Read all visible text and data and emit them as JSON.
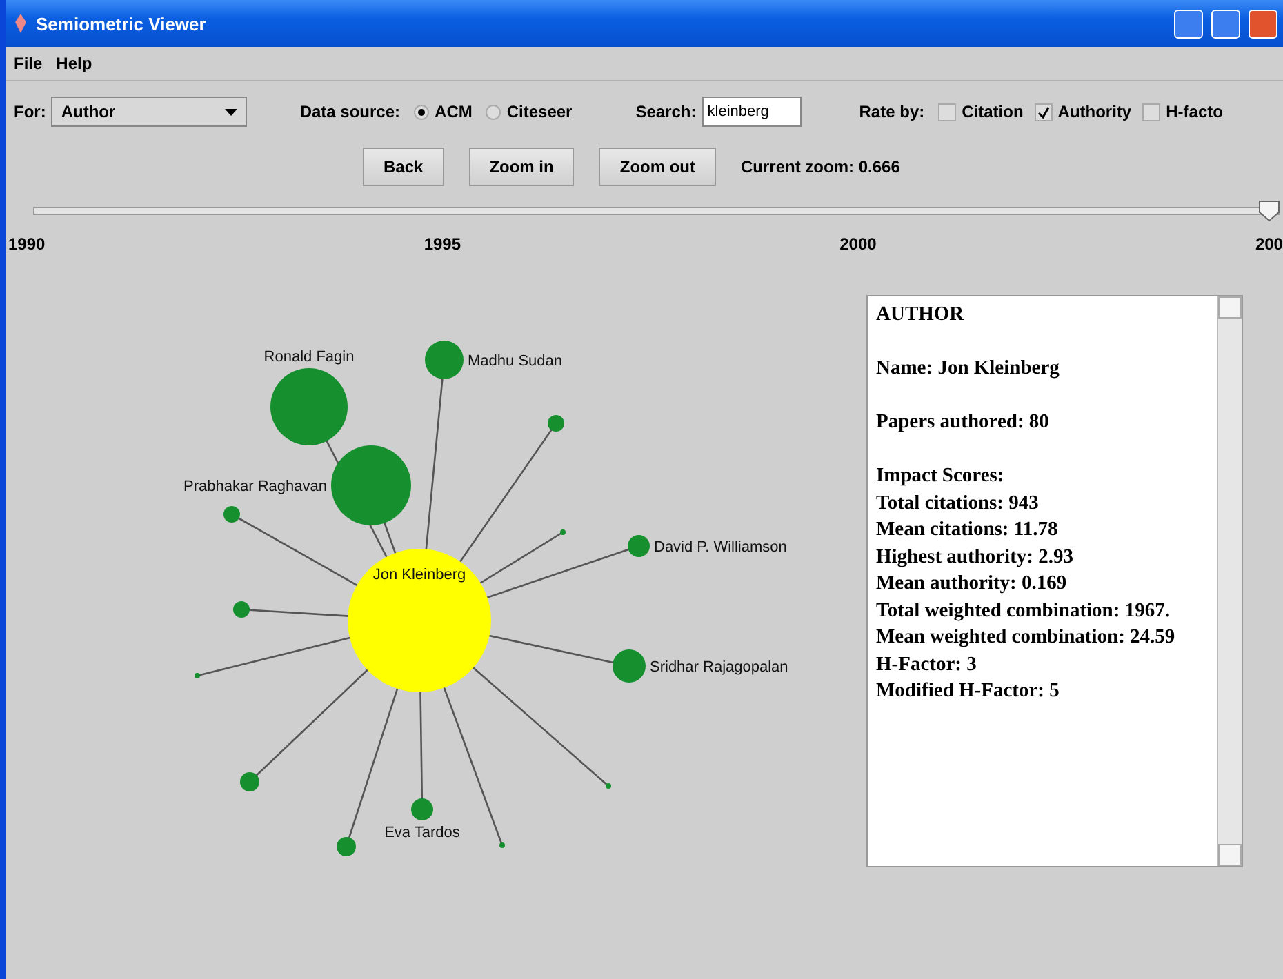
{
  "window": {
    "title": "Semiometric Viewer"
  },
  "menu": [
    "File",
    "Help"
  ],
  "toolbar": {
    "for_label": "For:",
    "for_value": "Author",
    "source_label": "Data source:",
    "sources": [
      {
        "label": "ACM",
        "selected": true
      },
      {
        "label": "Citeseer",
        "selected": false
      }
    ],
    "search_label": "Search:",
    "search_value": "kleinberg",
    "rate_label": "Rate by:",
    "rate_options": [
      {
        "label": "Citation",
        "checked": false
      },
      {
        "label": "Authority",
        "checked": true
      },
      {
        "label": "H-facto",
        "checked": false
      }
    ]
  },
  "buttons": [
    "Back",
    "Zoom in",
    "Zoom out"
  ],
  "zoom_text": "Current zoom: 0.666",
  "timeline": {
    "level": 1,
    "years": [
      "1990",
      "1995",
      "2000",
      "200"
    ]
  },
  "graph": {
    "nodes": [
      {
        "kind": "focus",
        "label": "Jon Kleinberg"
      },
      {
        "kind": "coauthor",
        "label": "Ronald Fagin"
      },
      {
        "kind": "coauthor",
        "label": "Prabhakar Raghavan"
      },
      {
        "kind": "coauthor",
        "label": "Madhu Sudan"
      },
      {
        "kind": "coauthor"
      },
      {
        "kind": "coauthor"
      },
      {
        "kind": "coauthor"
      },
      {
        "kind": "coauthor",
        "label": "David P. Williamson"
      },
      {
        "kind": "coauthor"
      },
      {
        "kind": "coauthor"
      },
      {
        "kind": "coauthor",
        "label": "Sridhar Rajagopalan"
      },
      {
        "kind": "coauthor"
      },
      {
        "kind": "coauthor"
      },
      {
        "kind": "coauthor",
        "label": "Eva Tardos"
      },
      {
        "kind": "coauthor"
      },
      {
        "kind": "coauthor"
      }
    ]
  },
  "info": [
    [
      "AUTHOR"
    ],
    [
      "Name: Jon Kleinberg"
    ],
    [
      "Papers authored: 80"
    ],
    [
      "Impact Scores:",
      "Total citations: 943",
      "Mean citations: 11.78",
      "Highest authority: 2.93",
      "Mean authority: 0.169",
      "Total weighted combination: 1967.",
      "Mean weighted combination: 24.59",
      "H-Factor: 3",
      "Modified H-Factor: 5"
    ]
  ]
}
